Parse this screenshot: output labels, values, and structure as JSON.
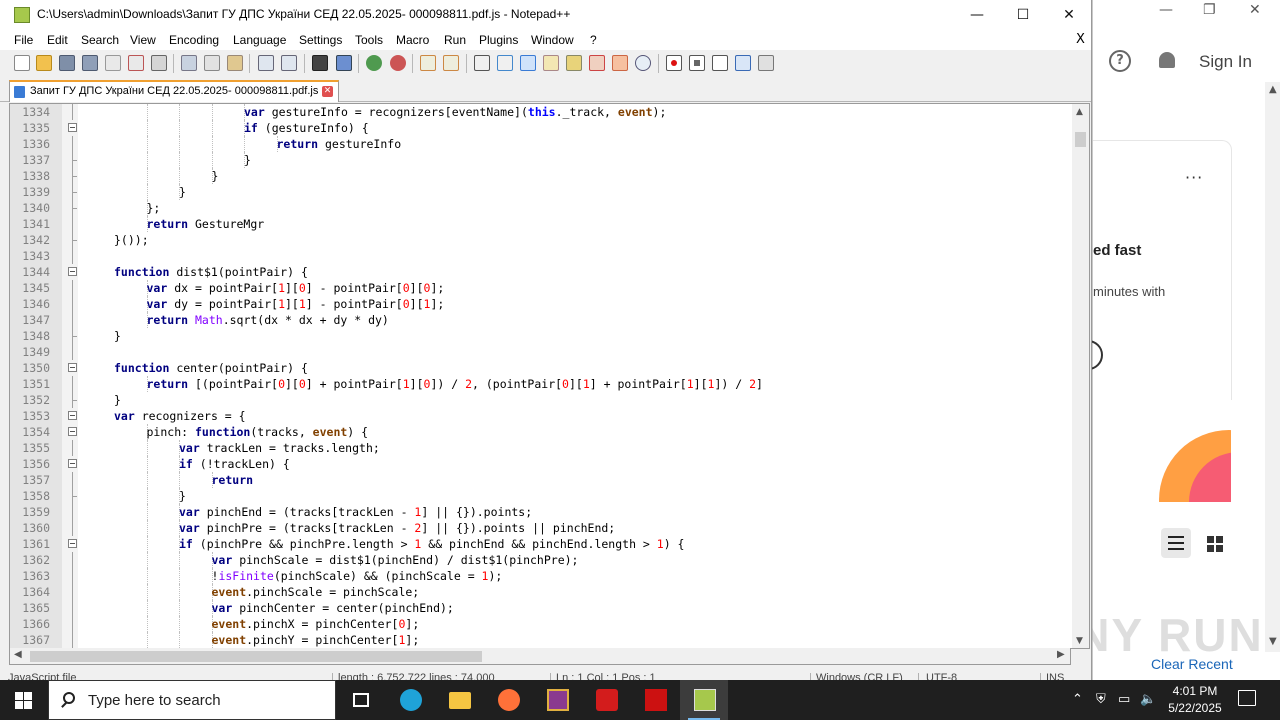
{
  "window": {
    "title": "C:\\Users\\admin\\Downloads\\Запит ГУ ДПС України СЕД 22.05.2025- 000098811.pdf.js - Notepad++",
    "min_glyph": "—",
    "max_glyph": "☐",
    "close_glyph": "✕"
  },
  "menu": {
    "items": [
      "File",
      "Edit",
      "Search",
      "View",
      "Encoding",
      "Language",
      "Settings",
      "Tools",
      "Macro",
      "Run",
      "Plugins",
      "Window",
      "?"
    ],
    "close_doc": "X"
  },
  "toolbar": {
    "icons": [
      "new-file",
      "open-file",
      "save",
      "save-all",
      "close",
      "close-all",
      "print",
      "cut",
      "copy",
      "paste",
      "undo",
      "redo",
      "find",
      "replace",
      "zoom-in",
      "zoom-out",
      "sync-vertical",
      "sync-horizontal",
      "word-wrap",
      "show-all-chars",
      "indent-guide",
      "doc-map",
      "function-list",
      "folder-as-workspace",
      "doc-list",
      "monitoring",
      "record-macro",
      "stop-record",
      "play-macro",
      "run-macro-multiple",
      "save-macro"
    ]
  },
  "tab": {
    "label": "Запит ГУ ДПС України СЕД 22.05.2025- 000098811.pdf.js",
    "close": "✕"
  },
  "editor": {
    "lines": [
      {
        "n": "1334",
        "indent": 5,
        "fold": "line",
        "code": [
          [
            "kw2",
            "var"
          ],
          [
            "p",
            " gestureInfo = recognizers[eventName]("
          ],
          [
            "kw",
            "this"
          ],
          [
            "p",
            "._track, "
          ],
          [
            "ev",
            "event"
          ],
          [
            "p",
            ");"
          ]
        ]
      },
      {
        "n": "1335",
        "indent": 5,
        "fold": "box",
        "code": [
          [
            "kw2",
            "if"
          ],
          [
            "p",
            " (gestureInfo) {"
          ]
        ]
      },
      {
        "n": "1336",
        "indent": 6,
        "fold": "line",
        "code": [
          [
            "kw2",
            "return"
          ],
          [
            "p",
            " gestureInfo"
          ]
        ]
      },
      {
        "n": "1337",
        "indent": 5,
        "fold": "end",
        "code": [
          [
            "p",
            "}"
          ]
        ]
      },
      {
        "n": "1338",
        "indent": 4,
        "fold": "end",
        "code": [
          [
            "p",
            "}"
          ]
        ]
      },
      {
        "n": "1339",
        "indent": 3,
        "fold": "end",
        "code": [
          [
            "p",
            "}"
          ]
        ]
      },
      {
        "n": "1340",
        "indent": 2,
        "fold": "end",
        "code": [
          [
            "p",
            "};"
          ]
        ]
      },
      {
        "n": "1341",
        "indent": 2,
        "fold": "line",
        "code": [
          [
            "kw2",
            "return"
          ],
          [
            "p",
            " GestureMgr"
          ]
        ]
      },
      {
        "n": "1342",
        "indent": 1,
        "fold": "end",
        "code": [
          [
            "p",
            "}());"
          ]
        ]
      },
      {
        "n": "1343",
        "indent": 0,
        "fold": "line",
        "code": []
      },
      {
        "n": "1344",
        "indent": 1,
        "fold": "box",
        "code": [
          [
            "kw2",
            "function"
          ],
          [
            "p",
            " dist$1(pointPair) {"
          ]
        ]
      },
      {
        "n": "1345",
        "indent": 2,
        "fold": "line",
        "code": [
          [
            "kw2",
            "var"
          ],
          [
            "p",
            " dx = pointPair["
          ],
          [
            "num",
            "1"
          ],
          [
            "p",
            "]["
          ],
          [
            "num",
            "0"
          ],
          [
            "p",
            "] - pointPair["
          ],
          [
            "num",
            "0"
          ],
          [
            "p",
            "]["
          ],
          [
            "num",
            "0"
          ],
          [
            "p",
            "];"
          ]
        ]
      },
      {
        "n": "1346",
        "indent": 2,
        "fold": "line",
        "code": [
          [
            "kw2",
            "var"
          ],
          [
            "p",
            " dy = pointPair["
          ],
          [
            "num",
            "1"
          ],
          [
            "p",
            "]["
          ],
          [
            "num",
            "1"
          ],
          [
            "p",
            "] - pointPair["
          ],
          [
            "num",
            "0"
          ],
          [
            "p",
            "]["
          ],
          [
            "num",
            "1"
          ],
          [
            "p",
            "];"
          ]
        ]
      },
      {
        "n": "1347",
        "indent": 2,
        "fold": "line",
        "code": [
          [
            "kw2",
            "return"
          ],
          [
            "p",
            " "
          ],
          [
            "obj",
            "Math"
          ],
          [
            "p",
            ".sqrt(dx * dx + dy * dy)"
          ]
        ]
      },
      {
        "n": "1348",
        "indent": 1,
        "fold": "end",
        "code": [
          [
            "p",
            "}"
          ]
        ]
      },
      {
        "n": "1349",
        "indent": 0,
        "fold": "line",
        "code": []
      },
      {
        "n": "1350",
        "indent": 1,
        "fold": "box",
        "code": [
          [
            "kw2",
            "function"
          ],
          [
            "p",
            " center(pointPair) {"
          ]
        ]
      },
      {
        "n": "1351",
        "indent": 2,
        "fold": "line",
        "code": [
          [
            "kw2",
            "return"
          ],
          [
            "p",
            " [(pointPair["
          ],
          [
            "num",
            "0"
          ],
          [
            "p",
            "]["
          ],
          [
            "num",
            "0"
          ],
          [
            "p",
            "] + pointPair["
          ],
          [
            "num",
            "1"
          ],
          [
            "p",
            "]["
          ],
          [
            "num",
            "0"
          ],
          [
            "p",
            "]) / "
          ],
          [
            "num",
            "2"
          ],
          [
            "p",
            ", (pointPair["
          ],
          [
            "num",
            "0"
          ],
          [
            "p",
            "]["
          ],
          [
            "num",
            "1"
          ],
          [
            "p",
            "] + pointPair["
          ],
          [
            "num",
            "1"
          ],
          [
            "p",
            "]["
          ],
          [
            "num",
            "1"
          ],
          [
            "p",
            "]) / "
          ],
          [
            "num",
            "2"
          ],
          [
            "p",
            "]"
          ]
        ]
      },
      {
        "n": "1352",
        "indent": 1,
        "fold": "end",
        "code": [
          [
            "p",
            "}"
          ]
        ]
      },
      {
        "n": "1353",
        "indent": 1,
        "fold": "box",
        "code": [
          [
            "kw2",
            "var"
          ],
          [
            "p",
            " recognizers = {"
          ]
        ]
      },
      {
        "n": "1354",
        "indent": 2,
        "fold": "box",
        "code": [
          [
            "p",
            "pinch: "
          ],
          [
            "kw2",
            "function"
          ],
          [
            "p",
            "(tracks, "
          ],
          [
            "ev",
            "event"
          ],
          [
            "p",
            ") {"
          ]
        ]
      },
      {
        "n": "1355",
        "indent": 3,
        "fold": "line",
        "code": [
          [
            "kw2",
            "var"
          ],
          [
            "p",
            " trackLen = tracks.length;"
          ]
        ]
      },
      {
        "n": "1356",
        "indent": 3,
        "fold": "box",
        "code": [
          [
            "kw2",
            "if"
          ],
          [
            "p",
            " (!trackLen) {"
          ]
        ]
      },
      {
        "n": "1357",
        "indent": 4,
        "fold": "line",
        "code": [
          [
            "kw2",
            "return"
          ]
        ]
      },
      {
        "n": "1358",
        "indent": 3,
        "fold": "end",
        "code": [
          [
            "p",
            "}"
          ]
        ]
      },
      {
        "n": "1359",
        "indent": 3,
        "fold": "line",
        "code": [
          [
            "kw2",
            "var"
          ],
          [
            "p",
            " pinchEnd = (tracks[trackLen - "
          ],
          [
            "num",
            "1"
          ],
          [
            "p",
            "] || {}).points;"
          ]
        ]
      },
      {
        "n": "1360",
        "indent": 3,
        "fold": "line",
        "code": [
          [
            "kw2",
            "var"
          ],
          [
            "p",
            " pinchPre = (tracks[trackLen - "
          ],
          [
            "num",
            "2"
          ],
          [
            "p",
            "] || {}).points || pinchEnd;"
          ]
        ]
      },
      {
        "n": "1361",
        "indent": 3,
        "fold": "box",
        "code": [
          [
            "kw2",
            "if"
          ],
          [
            "p",
            " (pinchPre && pinchPre.length > "
          ],
          [
            "num",
            "1"
          ],
          [
            "p",
            " && pinchEnd && pinchEnd.length > "
          ],
          [
            "num",
            "1"
          ],
          [
            "p",
            ") {"
          ]
        ]
      },
      {
        "n": "1362",
        "indent": 4,
        "fold": "line",
        "code": [
          [
            "kw2",
            "var"
          ],
          [
            "p",
            " pinchScale = dist$1(pinchEnd) / dist$1(pinchPre);"
          ]
        ]
      },
      {
        "n": "1363",
        "indent": 4,
        "fold": "line",
        "code": [
          [
            "p",
            "!"
          ],
          [
            "obj",
            "isFinite"
          ],
          [
            "p",
            "(pinchScale) && (pinchScale = "
          ],
          [
            "num",
            "1"
          ],
          [
            "p",
            ");"
          ]
        ]
      },
      {
        "n": "1364",
        "indent": 4,
        "fold": "line",
        "code": [
          [
            "ev",
            "event"
          ],
          [
            "p",
            ".pinchScale = pinchScale;"
          ]
        ]
      },
      {
        "n": "1365",
        "indent": 4,
        "fold": "line",
        "code": [
          [
            "kw2",
            "var"
          ],
          [
            "p",
            " pinchCenter = center(pinchEnd);"
          ]
        ]
      },
      {
        "n": "1366",
        "indent": 4,
        "fold": "line",
        "code": [
          [
            "ev",
            "event"
          ],
          [
            "p",
            ".pinchX = pinchCenter["
          ],
          [
            "num",
            "0"
          ],
          [
            "p",
            "];"
          ]
        ]
      },
      {
        "n": "1367",
        "indent": 4,
        "fold": "line",
        "code": [
          [
            "ev",
            "event"
          ],
          [
            "p",
            ".pinchY = pinchCenter["
          ],
          [
            "num",
            "1"
          ],
          [
            "p",
            "];"
          ]
        ]
      }
    ]
  },
  "statusbar": {
    "lang": "JavaScript file",
    "length": "length : 6,752,722    lines : 74,000",
    "pos": "Ln : 1    Col : 1    Pos : 1",
    "eol": "Windows (CR LF)",
    "encoding": "UTF-8",
    "mode": "INS"
  },
  "bgapp": {
    "min": "—",
    "max": "❐",
    "close": "✕",
    "help": "?",
    "signin": "Sign In",
    "more": "···",
    "card_title": "ed fast",
    "card_text": "minutes with",
    "clear_recent": "Clear Recent",
    "watermark": "ANY RUN"
  },
  "taskbar": {
    "search_placeholder": "Type here to search",
    "apps": [
      "task-view",
      "edge",
      "file-explorer",
      "firefox",
      "winrar",
      "acrobat",
      "any-run-app",
      "notepad-plus-plus"
    ],
    "time": "4:01 PM",
    "date": "5/22/2025"
  }
}
